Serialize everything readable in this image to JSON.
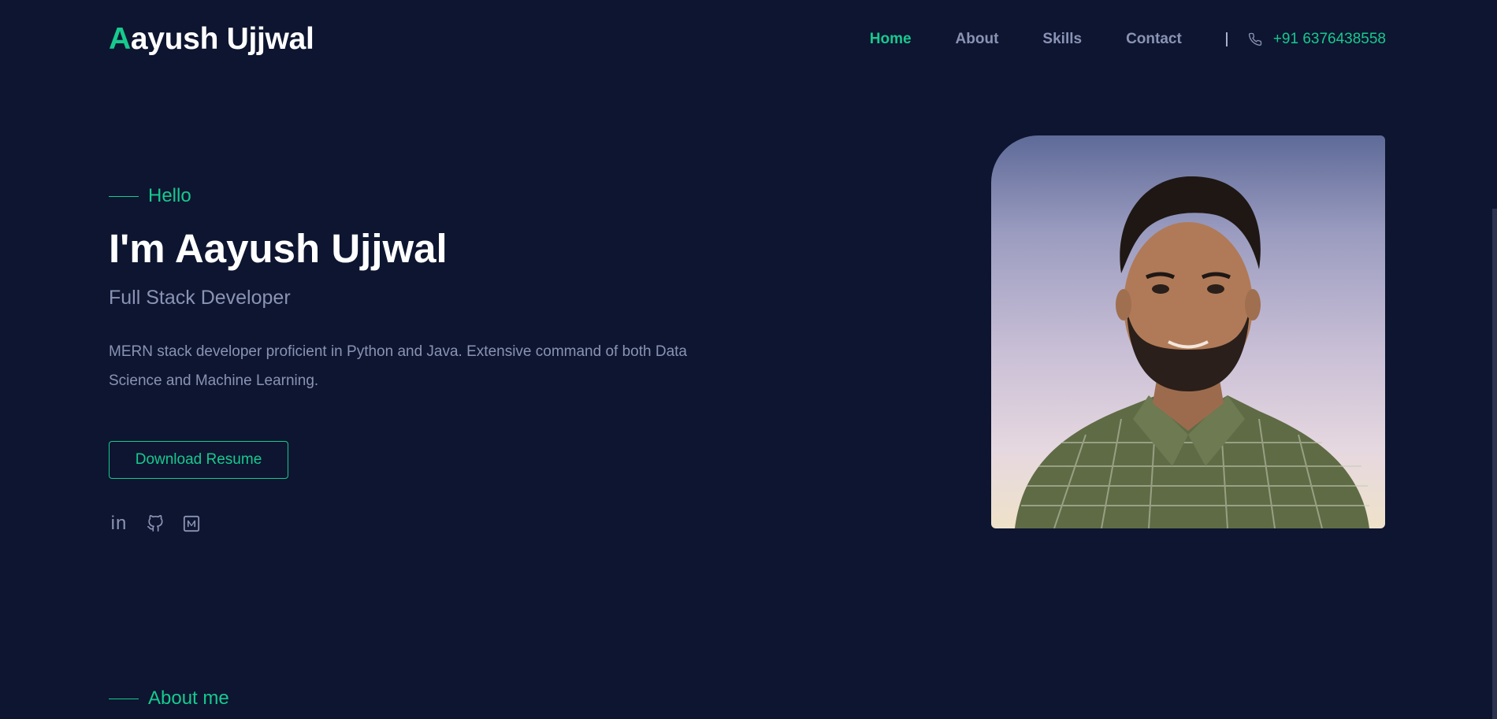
{
  "header": {
    "logo_first": "A",
    "logo_rest": "ayush Ujjwal",
    "nav": [
      {
        "label": "Home",
        "active": true
      },
      {
        "label": "About",
        "active": false
      },
      {
        "label": "Skills",
        "active": false
      },
      {
        "label": "Contact",
        "active": false
      }
    ],
    "phone": "+91 6376438558"
  },
  "hero": {
    "greeting": "Hello",
    "title": "I'm Aayush Ujjwal",
    "subtitle": "Full Stack Developer",
    "description": "MERN stack developer proficient in Python and Java. Extensive command of both Data Science and Machine Learning.",
    "button_label": "Download Resume",
    "socials": [
      "linkedin-icon",
      "github-icon",
      "medium-icon"
    ],
    "linkedin_text": "in"
  },
  "about": {
    "label": "About me"
  },
  "colors": {
    "background": "#0d1530",
    "accent": "#17c98e",
    "muted_text": "#8a93b4",
    "heading": "#ffffff"
  }
}
